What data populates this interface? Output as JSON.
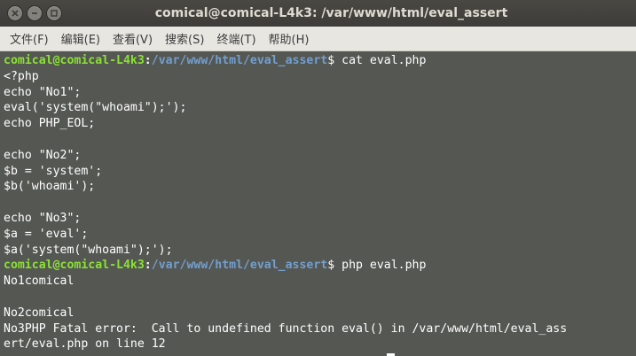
{
  "window": {
    "title": "comical@comical-L4k3: /var/www/html/eval_assert",
    "buttons": [
      "close",
      "minimize",
      "maximize"
    ]
  },
  "menu": [
    {
      "label": "文件(F)"
    },
    {
      "label": "编辑(E)"
    },
    {
      "label": "查看(V)"
    },
    {
      "label": "搜索(S)"
    },
    {
      "label": "终端(T)"
    },
    {
      "label": "帮助(H)"
    }
  ],
  "terminal": {
    "colors": {
      "background": "#555753",
      "user": "#8ae234",
      "path": "#729fcf",
      "text": "#ffffff"
    },
    "prompt1": {
      "user": "comical@comical-L4k3",
      "sep": ":",
      "path": "/var/www/html/eval_assert",
      "symbol": "$",
      "command": " cat eval.php"
    },
    "file_lines": [
      "<?php",
      "echo \"No1\";",
      "eval('system(\"whoami\");');",
      "echo PHP_EOL;",
      "",
      "echo \"No2\";",
      "$b = 'system';",
      "$b('whoami');",
      "",
      "echo \"No3\";",
      "$a = 'eval';",
      "$a('system(\"whoami\");');"
    ],
    "prompt2": {
      "user": "comical@comical-L4k3",
      "sep": ":",
      "path": "/var/www/html/eval_assert",
      "symbol": "$",
      "command": " php eval.php"
    },
    "output_lines": [
      "No1comical",
      "",
      "No2comical",
      "No3PHP Fatal error:  Call to undefined function eval() in /var/www/html/eval_ass",
      "ert/eval.php on line 12"
    ]
  }
}
